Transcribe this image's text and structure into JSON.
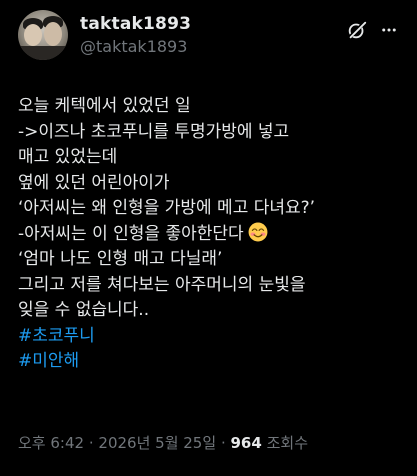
{
  "author": {
    "display_name": "taktak1893",
    "handle": "@taktak1893"
  },
  "post": {
    "lines": [
      "오늘 케텍에서 있었던 일",
      "->이즈나 초코푸니를 투명가방에 넣고",
      "매고 있었는데",
      "옆에 있던 어린아이가",
      "‘아저씨는 왜 인형을 가방에 메고 다녀요?’",
      "-아저씨는 이 인형을 좋아한단다",
      "‘엄마 나도 인형 매고 다닐래’",
      "그리고 저를 쳐다보는 아주머니의 눈빛을",
      "잊을 수 없습니다.."
    ],
    "emoji": "smiling-face-with-smiling-eyes-emoji",
    "hashtags": [
      "#초코푸니",
      "#미안해"
    ]
  },
  "meta": {
    "time": "오후 6:42",
    "separator": "·",
    "date": "2026년 5월 25일",
    "views_count": "964",
    "views_label": "조회수"
  },
  "colors": {
    "background": "#000000",
    "text": "#e7e9ea",
    "secondary": "#71767b",
    "link": "#1d9bf0"
  },
  "icons": [
    "grok-icon",
    "more-icon"
  ]
}
